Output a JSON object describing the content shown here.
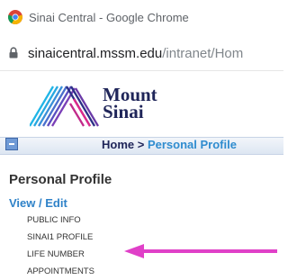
{
  "window": {
    "title": "Sinai Central - Google Chrome"
  },
  "address_bar": {
    "host": "sinaicentral.mssm.edu",
    "path": "/intranet/Hom"
  },
  "logo": {
    "line1": "Mount",
    "line2": "Sinai"
  },
  "breadcrumb": {
    "home": "Home",
    "separator": ">",
    "current": "Personal Profile"
  },
  "page": {
    "heading": "Personal Profile",
    "section": "View / Edit"
  },
  "menu": [
    {
      "label": "PUBLIC INFO"
    },
    {
      "label": "SINAI1 PROFILE"
    },
    {
      "label": "LIFE NUMBER"
    },
    {
      "label": "APPOINTMENTS"
    }
  ],
  "annotation": {
    "color": "#e040c8",
    "points_to": "LIFE NUMBER"
  }
}
